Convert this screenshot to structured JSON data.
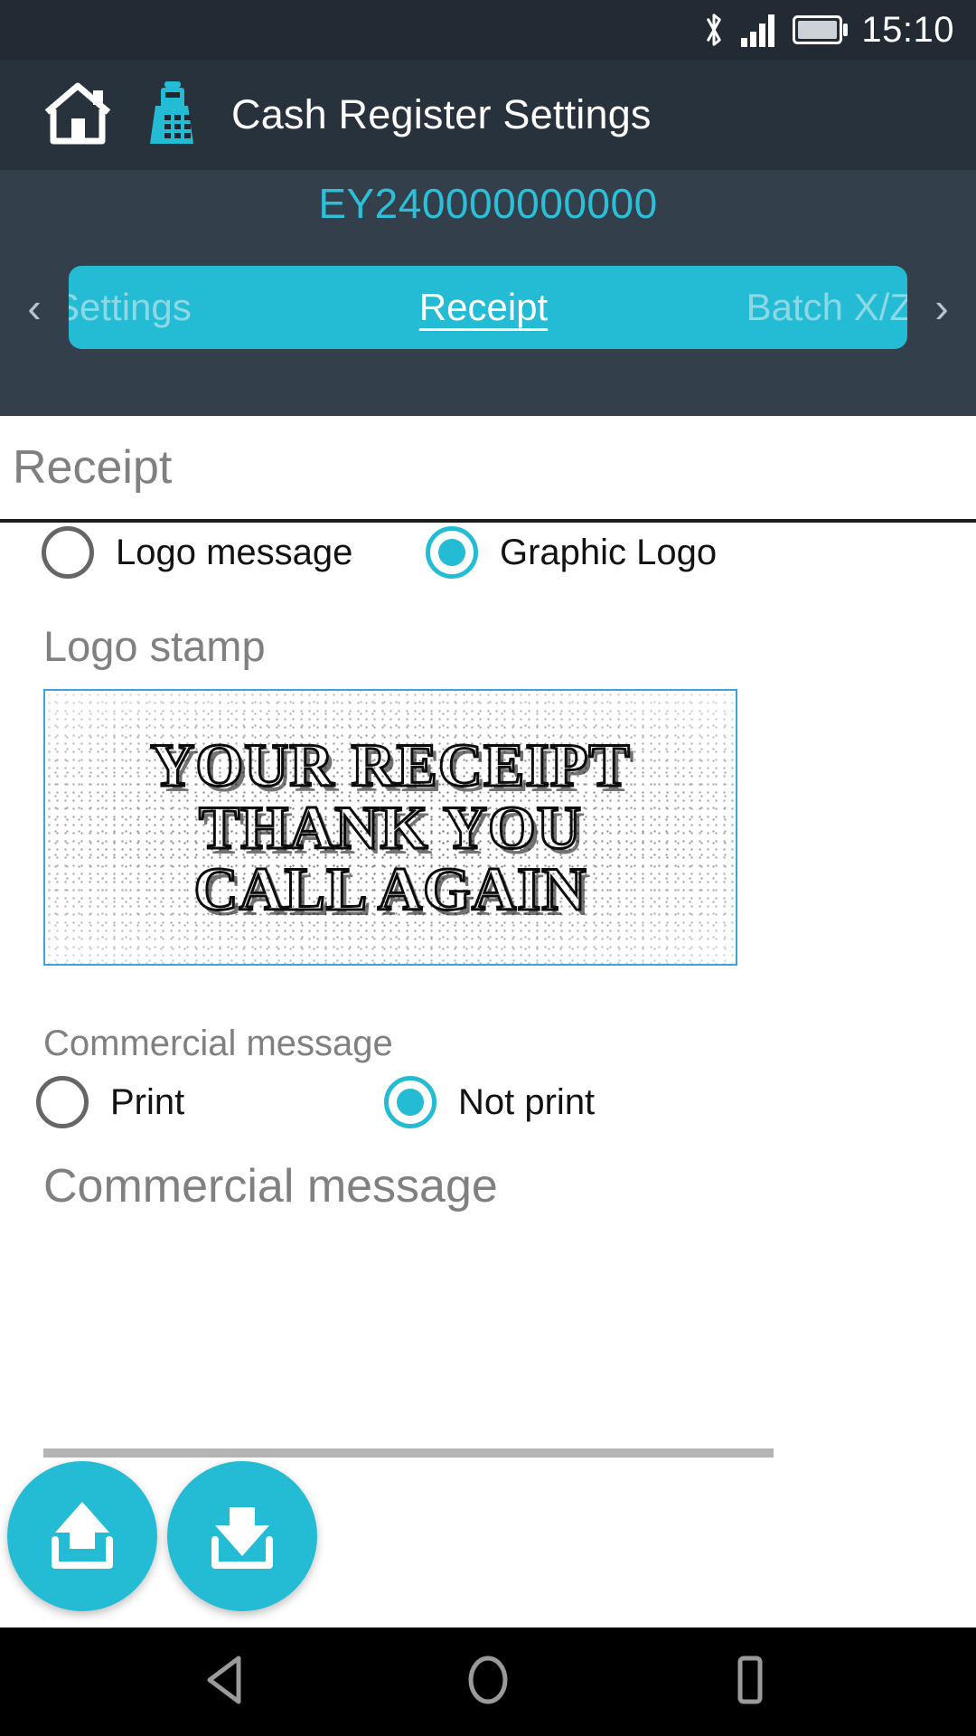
{
  "status_bar": {
    "time": "15:10",
    "icons": [
      "bluetooth-icon",
      "signal-icon",
      "battery-icon"
    ]
  },
  "app_bar": {
    "home_icon": "home-icon",
    "register_icon": "cash-register-icon",
    "title": "Cash Register Settings"
  },
  "subheader": {
    "device_id": "EY240000000000",
    "prev_arrow": "‹",
    "next_arrow": "›",
    "tabs": [
      {
        "label": "Settings",
        "active": false
      },
      {
        "label": "Receipt",
        "active": true
      },
      {
        "label": "Batch X/Z",
        "active": false
      }
    ]
  },
  "section": {
    "title": "Receipt"
  },
  "logo_mode": {
    "options": [
      {
        "label": "Logo message",
        "selected": false
      },
      {
        "label": "Graphic Logo",
        "selected": true
      }
    ]
  },
  "logo_stamp": {
    "label": "Logo stamp",
    "image_lines": [
      "YOUR RECEIPT",
      "THANK YOU",
      "CALL AGAIN"
    ]
  },
  "commercial_message": {
    "caption": "Commercial message",
    "options": [
      {
        "label": "Print",
        "selected": false
      },
      {
        "label": "Not print",
        "selected": true
      }
    ],
    "input_placeholder": "Commercial message",
    "input_value": ""
  },
  "actions": {
    "upload_label": "upload-icon",
    "download_label": "download-icon"
  },
  "nav_bar": {
    "back": "back-icon",
    "home": "home-circle-icon",
    "recents": "recents-icon"
  },
  "colors": {
    "accent": "#23bcd4",
    "appbar": "#28323c",
    "subheader": "#333f4b",
    "statusbar": "#222b33",
    "device_id": "#2bc0d8",
    "muted_text": "#808080"
  }
}
